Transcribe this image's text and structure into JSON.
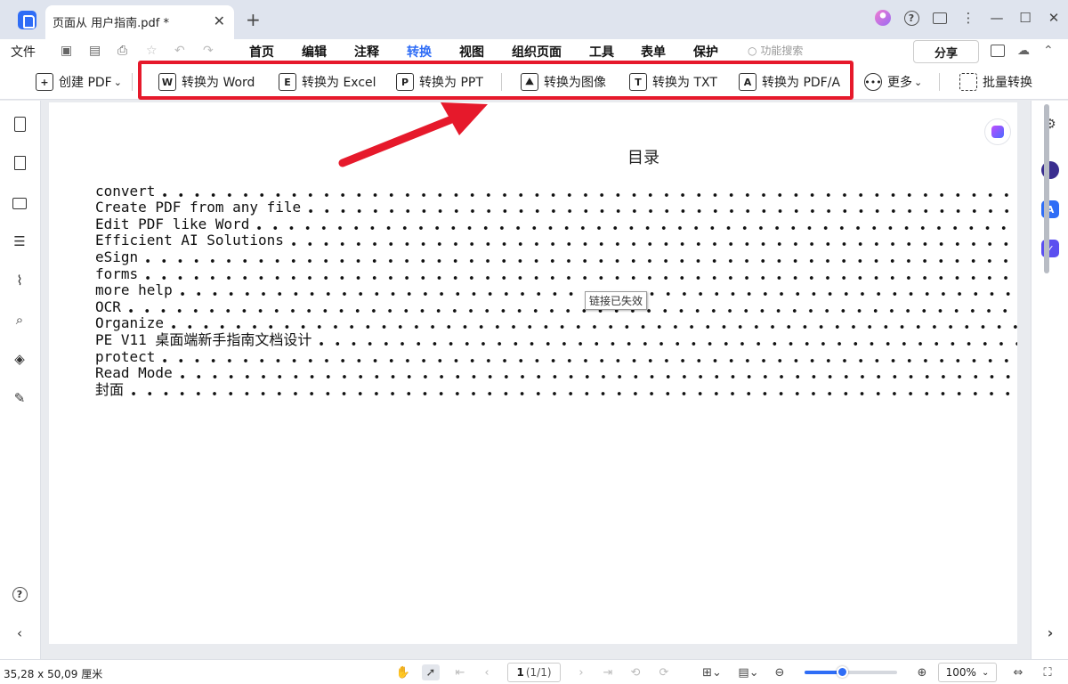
{
  "tab": {
    "title": "页面从 用户指南.pdf *",
    "close": "✕",
    "new": "+"
  },
  "window": {
    "help": "?",
    "more": "⋮",
    "minimize": "—",
    "maximize": "☐",
    "close": "✕"
  },
  "menu": {
    "file": "文件",
    "items": [
      "首页",
      "编辑",
      "注释",
      "转换",
      "视图",
      "组织页面",
      "工具",
      "表单",
      "保护"
    ],
    "active": "转换",
    "search_placeholder": "功能搜索",
    "search_icon": "○",
    "share": "分享"
  },
  "toolbar": {
    "create_pdf": "创建 PDF",
    "to_word": "转换为 Word",
    "to_excel": "转换为 Excel",
    "to_ppt": "转换为 PPT",
    "to_image": "转换为图像",
    "to_txt": "转换为 TXT",
    "to_pdfa": "转换为 PDF/A",
    "more": "更多",
    "batch": "批量转换",
    "icon_letters": {
      "word": "W",
      "excel": "E",
      "ppt": "P",
      "txt": "T",
      "pdfa": "A",
      "plus": "+",
      "more": "•••",
      "image": "⛰"
    },
    "caret": "⌄"
  },
  "document": {
    "title": "目录",
    "toc": [
      "convert",
      "Create PDF from any file",
      "Edit PDF like Word",
      "Efficient AI Solutions",
      "eSign",
      "forms",
      "more help",
      "OCR",
      "Organize",
      "PE V11 桌面端新手指南文档设计",
      "protect",
      "Read Mode",
      "封面"
    ],
    "tooltip": "链接已失效"
  },
  "left_sidebar": {
    "help": "?",
    "collapse": "‹"
  },
  "right_sidebar": {
    "expand": "›",
    "icon_letters": {
      "translate": "A",
      "check": "✓"
    }
  },
  "status": {
    "dimensions": "35,28 x 50,09 厘米",
    "page_current": "1",
    "page_total": "(1/1)",
    "zoom": "100%",
    "zoom_level": 0.4,
    "icon_glyphs": {
      "zoom_out": "⊖",
      "zoom_in": "⊕",
      "caret": "⌄"
    }
  },
  "colors": {
    "accent": "#2f6df6",
    "highlight": "#e6192b"
  }
}
